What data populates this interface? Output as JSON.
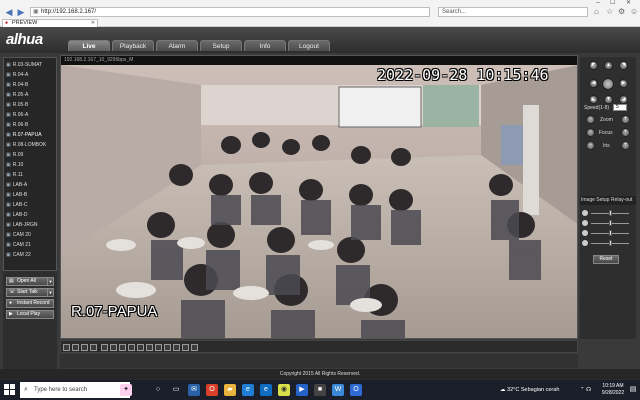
{
  "browser": {
    "url": "http://192.168.2.167/",
    "search_placeholder": "Search...",
    "tab_title": "PREVIEW",
    "icons": [
      "back-icon",
      "forward-icon",
      "home-icon",
      "star-icon",
      "gear-icon",
      "smiley-icon"
    ]
  },
  "app": {
    "logo": "alhua",
    "nav": [
      "Live",
      "Playback",
      "Alarm",
      "Setup",
      "Info",
      "Logout"
    ],
    "active_nav": "Live"
  },
  "cameras": [
    "R.03-SUMAT",
    "R.04-A",
    "R.04-B",
    "R.05-A",
    "R.05-B",
    "R.06-A",
    "R.06-B",
    "R.07-PAPUA",
    "R.08-LOMBOK",
    "R.09",
    "R.10",
    "R.11",
    "LAB-A",
    "LAB-B",
    "LAB-C",
    "LAB-D",
    "LAB-JRGN",
    "CAM 20",
    "CAM 21",
    "CAM 22"
  ],
  "side_buttons": {
    "open_all": "Open All",
    "start_talk": "Start Talk",
    "instant_record": "Instant Record",
    "local_play": "Local Play"
  },
  "video": {
    "info": "192.168.2.167_10_9296bps_M",
    "timestamp": "2022-09-28 10:15:46",
    "channel_name": "R.07-PAPUA"
  },
  "ptz": {
    "speed_label": "Speed(1-8)",
    "speed_value": "5",
    "zoom_label": "Zoom",
    "focus_label": "Focus",
    "iris_label": "Iris"
  },
  "image_setup": {
    "tab_image": "Image Setup",
    "tab_relay": "Relay-out",
    "reset": "Reset",
    "sliders": [
      0.5,
      0.5,
      0.5,
      0.5
    ]
  },
  "footer": {
    "copyright": "Copyright 2015 All Rights Reserved."
  },
  "taskbar": {
    "search_placeholder": "Type here to search",
    "weather": "32°C  Sebagian cerah",
    "time": "10:19 AM",
    "date": "9/28/2022"
  },
  "colors": {
    "app_bg": "#3a3a3a",
    "taskbar_bg": "#1b1f2a",
    "accent": "#4a72b8"
  }
}
